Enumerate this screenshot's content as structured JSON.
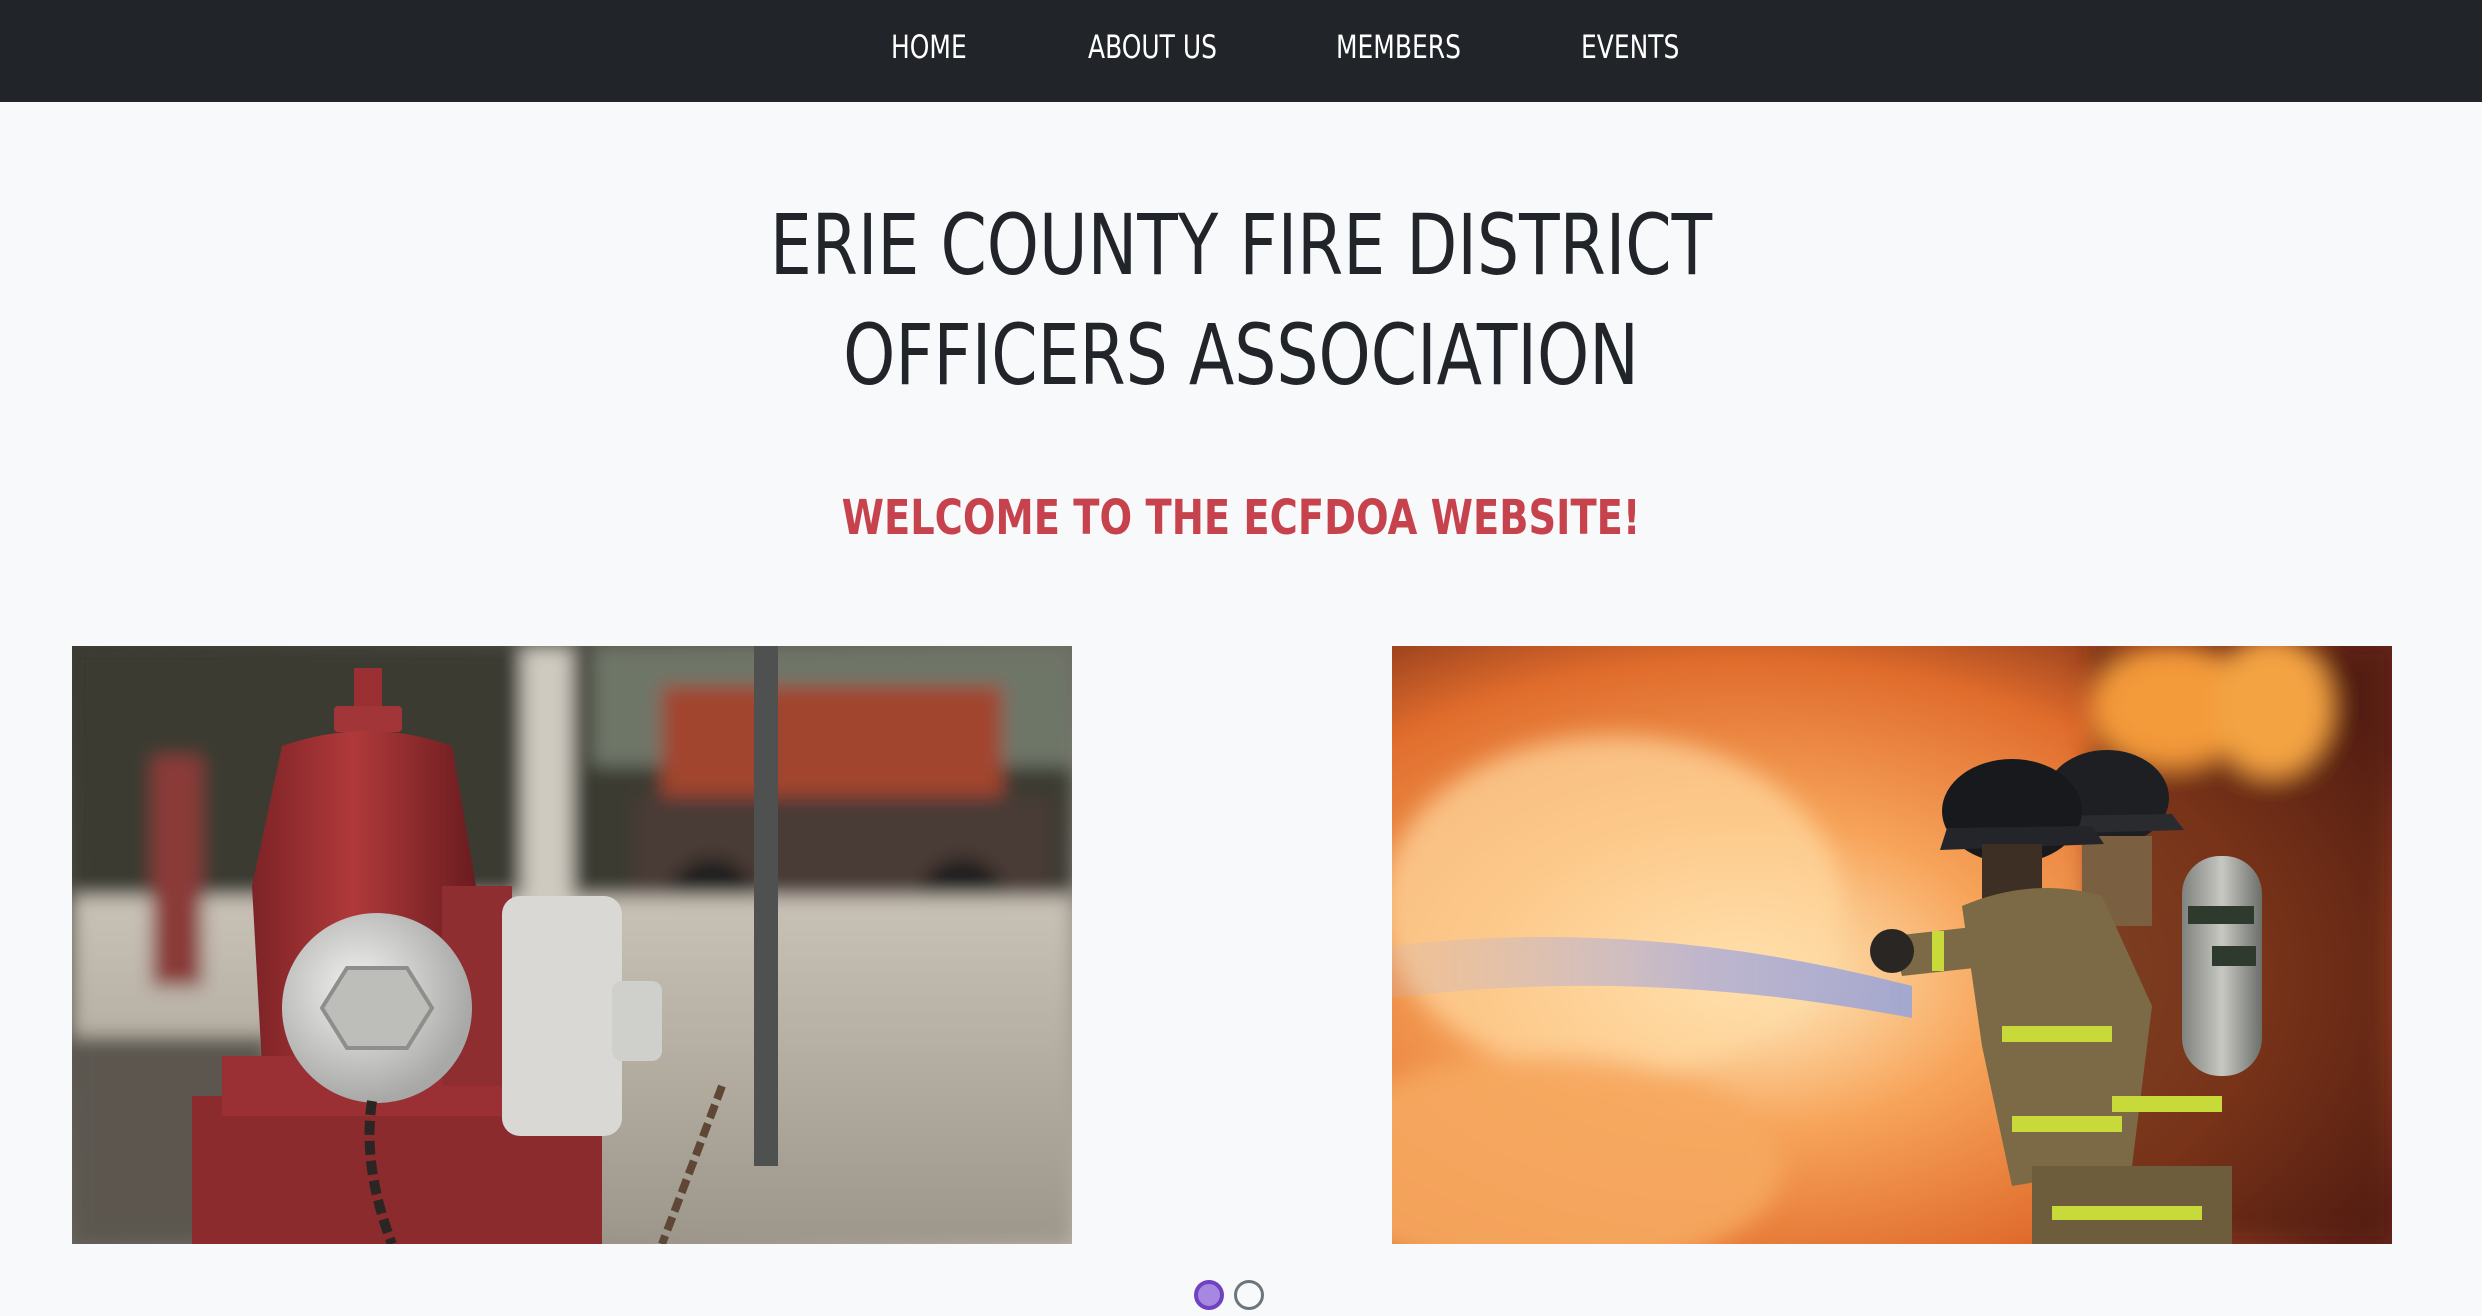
{
  "nav": {
    "items": [
      {
        "label": "HOME"
      },
      {
        "label": "ABOUT US"
      },
      {
        "label": "MEMBERS"
      },
      {
        "label": "EVENTS"
      }
    ]
  },
  "hero": {
    "title_line1": "ERIE COUNTY FIRE DISTRICT",
    "title_line2": "OFFICERS ASSOCIATION",
    "welcome": "WELCOME TO THE ECFDOA WEBSITE!"
  },
  "carousel": {
    "slides": [
      {
        "image": "fire-hydrant-photo"
      },
      {
        "image": "firefighters-hose-flames-photo"
      }
    ],
    "active_index": 1,
    "count": 2
  },
  "colors": {
    "navbar_bg": "#212529",
    "page_bg": "#f8f9fa",
    "title_text": "#212529",
    "welcome_text": "#c6434d",
    "active_dot": "#6f42c1"
  }
}
